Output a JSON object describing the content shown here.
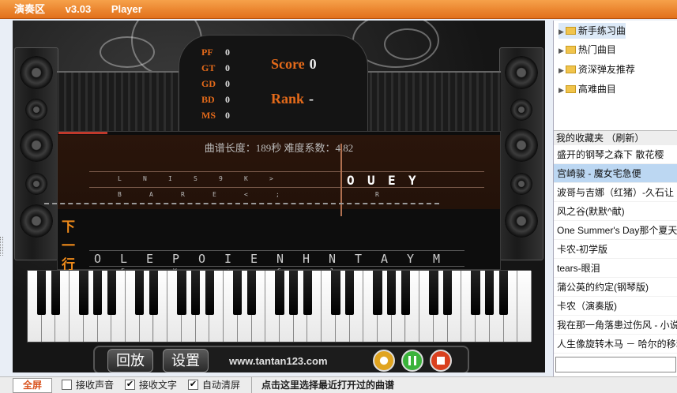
{
  "window": {
    "app": "演奏区",
    "version": "v3.03",
    "mode": "Player"
  },
  "stats": [
    {
      "label": "PF",
      "value": "0"
    },
    {
      "label": "GT",
      "value": "0"
    },
    {
      "label": "GD",
      "value": "0"
    },
    {
      "label": "BD",
      "value": "0"
    },
    {
      "label": "MS",
      "value": "0"
    }
  ],
  "score": {
    "label": "Score",
    "value": "0"
  },
  "rank": {
    "label": "Rank",
    "value": "-"
  },
  "progress_fraction": 0.11,
  "song_info": "曲谱长度：189秒  难度系数：4.82",
  "current_row": {
    "upper_keys": [
      "L",
      "N",
      "I",
      "S",
      "9",
      "K",
      ">"
    ],
    "lower_keys": [
      "B",
      "A",
      "R",
      "E",
      "<",
      ";"
    ],
    "active_keys": [
      "O",
      "U",
      "E",
      "Y"
    ],
    "active_sub": "R"
  },
  "next_row": {
    "label": "下一行",
    "keys": [
      "O",
      "L",
      "E",
      "P",
      "O",
      "I",
      "E",
      "N",
      "H",
      "N",
      "T",
      "A",
      "Y",
      "M"
    ],
    "sub": [
      "F",
      "V",
      "<",
      "G",
      "J"
    ]
  },
  "controls": {
    "replay": "回放",
    "settings": "设置",
    "url": "www.tantan123.com"
  },
  "sidebar": {
    "tree": [
      "新手练习曲",
      "热门曲目",
      "资深弹友推荐",
      "高难曲目"
    ],
    "favorites_title": "我的收藏夹 （刷新）",
    "favorites": [
      "盛开的钢琴之森下 散花樱",
      "宫崎骏 - 魔女宅急便",
      "波哥与吉娜（红猪）-久石让",
      "风之谷(默默^献)",
      "One Summer's Day那个夏天",
      "卡农-初学版",
      "tears-眼泪",
      "蒲公英的约定(钢琴版)",
      "卡农（演奏版)",
      "我在那一角落患过伤风 - 小说",
      "人生像旋转木马 － 哈尔的移动城堡"
    ],
    "selected_index": 1
  },
  "bottom": {
    "fullscreen": "全屏",
    "options": [
      {
        "label": "接收声音",
        "checked": false
      },
      {
        "label": "接收文字",
        "checked": true
      },
      {
        "label": "自动清屏",
        "checked": true
      }
    ],
    "hint": "点击这里选择最近打开过的曲谱"
  },
  "colors": {
    "accent": "#e46a1a",
    "titlebar": "#e98a34",
    "selected": "#bcd7f2",
    "play": "#3bb33b",
    "stop": "#d9401e",
    "pause": "#e0a420"
  }
}
